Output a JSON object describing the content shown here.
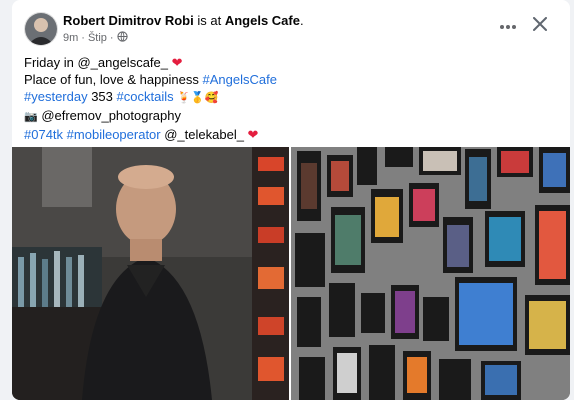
{
  "post": {
    "author": "Robert Dimitrov Robi",
    "is_at": "is at",
    "place": "Angels Cafe",
    "time": "9m",
    "location": "Štip",
    "separator": "·",
    "lines": {
      "l1_text": "Friday in @_angelscafe_",
      "l1_emoji": "❤",
      "l2_text": "Place of fun, love & happiness ",
      "l2_tag": "#AngelsCafe",
      "l3_tag1": "#yesterday",
      "l3_mid": " 353 ",
      "l3_tag2": "#cocktails",
      "l3_emoji": "🍹🥇🥰",
      "l4_emoji": "📷",
      "l4_text": " @efremov_photography",
      "l5_tag1": "#074tk",
      "l5_tag2": "#mobileoperator",
      "l5_text": " @_telekabel_ ",
      "l5_emoji": "❤"
    }
  },
  "icons": {
    "more": "more-dots-icon",
    "close": "close-icon",
    "privacy": "globe-icon"
  },
  "colors": {
    "link": "#216fdb",
    "heart": "#e41e3f",
    "text": "#050505",
    "meta": "#65676b"
  }
}
